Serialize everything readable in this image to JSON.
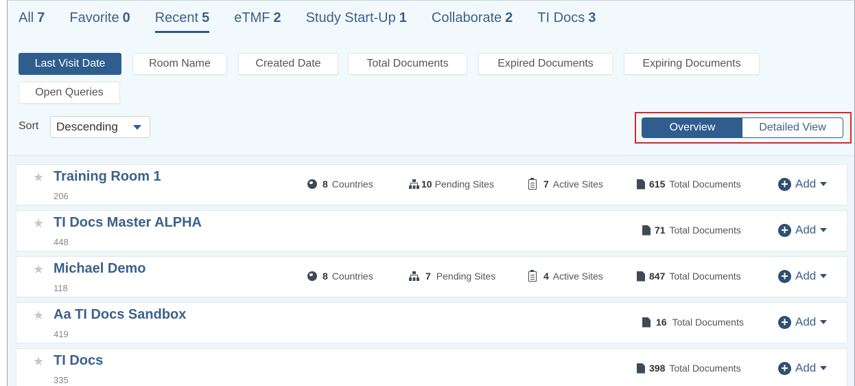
{
  "tabs": [
    {
      "label": "All",
      "count": "7"
    },
    {
      "label": "Favorite",
      "count": "0"
    },
    {
      "label": "Recent",
      "count": "5"
    },
    {
      "label": "eTMF",
      "count": "2"
    },
    {
      "label": "Study Start-Up",
      "count": "1"
    },
    {
      "label": "Collaborate",
      "count": "2"
    },
    {
      "label": "TI Docs",
      "count": "3"
    }
  ],
  "active_tab": "Recent",
  "sort_fields": [
    "Last Visit Date",
    "Room Name",
    "Created Date",
    "Total Documents",
    "Expired Documents",
    "Expiring Documents",
    "Open Queries"
  ],
  "active_sort_field": "Last Visit Date",
  "sort": {
    "label": "Sort",
    "value": "Descending"
  },
  "view_toggle": {
    "overview": "Overview",
    "detailed": "Detailed View",
    "selected": "Overview"
  },
  "stat_labels": {
    "countries": "Countries",
    "pending": "Pending Sites",
    "active": "Active Sites",
    "documents": "Total Documents"
  },
  "add_label": "Add",
  "rooms": [
    {
      "name": "Training Room 1",
      "id": "206",
      "countries": "8",
      "pending_sites": "10",
      "active_sites": "7",
      "total_documents": "615"
    },
    {
      "name": "TI Docs Master ALPHA",
      "id": "448",
      "total_documents": "71"
    },
    {
      "name": "Michael Demo",
      "id": "118",
      "countries": "8",
      "pending_sites": "7",
      "active_sites": "4",
      "total_documents": "847"
    },
    {
      "name": "Aa TI Docs Sandbox",
      "id": "419",
      "total_documents": "16"
    },
    {
      "name": "TI Docs",
      "id": "335",
      "total_documents": "398"
    }
  ],
  "colors": {
    "accent": "#2f5e8e",
    "link": "#3c6189",
    "highlight": "#d9262b",
    "panel": "#f2f9fc"
  }
}
